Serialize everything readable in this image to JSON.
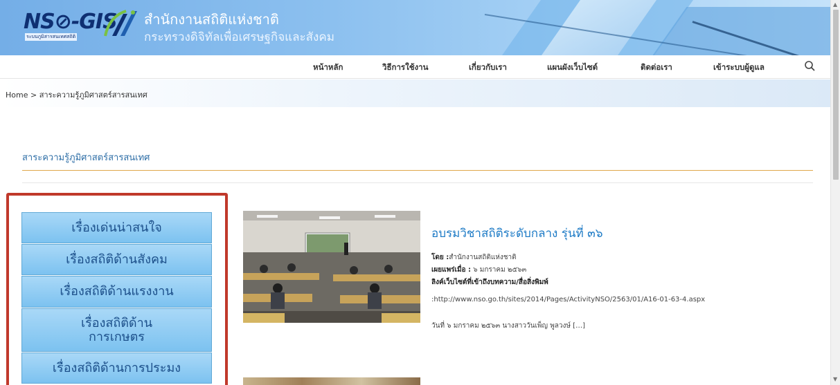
{
  "header": {
    "logo_text": "NS⊘-GIS",
    "logo_sub": "ระบบภูมิสารสนเทศสถิติ",
    "org_name": "สำนักงานสถิติแห่งชาติ",
    "org_sub": "กระทรวงดิจิทัลเพื่อเศรษฐกิจและสังคม"
  },
  "nav": {
    "items": [
      "หน้าหลัก",
      "วิธีการใช้งาน",
      "เกี่ยวกับเรา",
      "แผนผังเว็บไซต์",
      "ติดต่อเรา",
      "เข้าระบบผู้ดูแล"
    ],
    "search_icon": "search-icon"
  },
  "breadcrumb": "Home > สาระความรู้ภูมิศาสตร์สารสนเทศ",
  "section_title": "สาระความรู้ภูมิศาสตร์สารสนเทศ",
  "menu": {
    "items": [
      "เรื่องเด่นน่าสนใจ",
      "เรื่องสถิติด้านสังคม",
      "เรื่องสถิติด้านแรงงาน",
      "เรื่องสถิติด้าน\nการเกษตร",
      "เรื่องสถิติด้านการประมง"
    ],
    "highlight_color": "#c0392b"
  },
  "article": {
    "title": "อบรมวิชาสถิติระดับกลาง รุ่นที่ ๓๖",
    "by_label": "โดย :",
    "by_value": "สำนักงานสถิติแห่งชาติ",
    "date_label": "เผยแพร่เมื่อ :",
    "date_value": "๖ มกราคม ๒๕๖๓",
    "link_label": "ลิงค์เว็บไซต์ที่เข้าถึงบทความ/สื่อสิ่งพิมพ์",
    "link_value": ":http://www.nso.go.th/sites/2014/Pages/ActivityNSO/2563/01/A16-01-63-4.aspx",
    "excerpt": "วันที่ ๖ มกราคม ๒๕๖๓ นางสาววันเพ็ญ พูลวงษ์ […]"
  }
}
